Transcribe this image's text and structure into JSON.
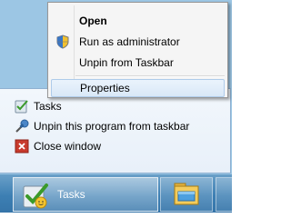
{
  "context_menu": {
    "items": [
      {
        "label": "Open",
        "icon": null,
        "bold": true
      },
      {
        "label": "Run as administrator",
        "icon": "uac-shield-icon"
      },
      {
        "label": "Unpin from Taskbar",
        "icon": null
      },
      {
        "label": "Properties",
        "icon": null,
        "highlighted": true
      }
    ]
  },
  "jump_list": {
    "items": [
      {
        "label": "Tasks",
        "icon": "tasks-app-icon"
      },
      {
        "label": "Unpin this program from taskbar",
        "icon": "pin-icon"
      },
      {
        "label": "Close window",
        "icon": "close-icon"
      }
    ]
  },
  "taskbar": {
    "active_app_label": "Tasks",
    "active_app_icon": "tasks-app-icon",
    "second_app_icon": "file-explorer-icon"
  },
  "colors": {
    "menu_highlight": "#d9e8f7",
    "taskbar": "#3d7fb3",
    "close_red": "#c83a2c"
  }
}
